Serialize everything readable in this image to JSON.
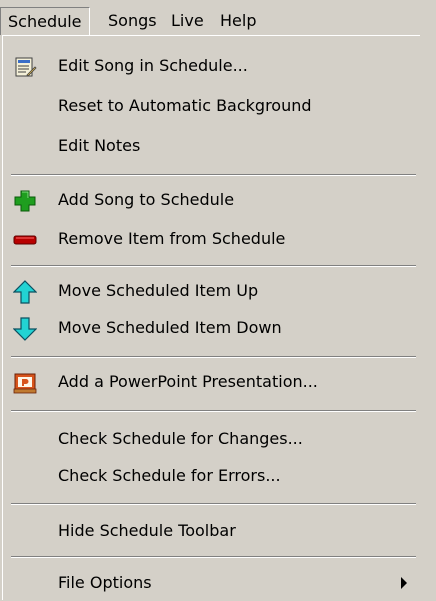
{
  "menubar": {
    "items": [
      {
        "label": "Schedule"
      },
      {
        "label": "Songs"
      },
      {
        "label": "Live"
      },
      {
        "label": "Help"
      }
    ]
  },
  "menu": {
    "items": [
      {
        "label": "Edit Song in Schedule...",
        "icon": "edit-song-icon"
      },
      {
        "label": "Reset to Automatic Background"
      },
      {
        "label": "Edit Notes"
      },
      {
        "label": "Add Song to Schedule",
        "icon": "plus-icon"
      },
      {
        "label": "Remove Item from Schedule",
        "icon": "minus-icon"
      },
      {
        "label": "Move Scheduled Item Up",
        "icon": "arrow-up-icon"
      },
      {
        "label": "Move Scheduled Item Down",
        "icon": "arrow-down-icon"
      },
      {
        "label": "Add a PowerPoint Presentation...",
        "icon": "powerpoint-icon"
      },
      {
        "label": "Check Schedule for Changes..."
      },
      {
        "label": "Check Schedule for Errors..."
      },
      {
        "label": "Hide Schedule Toolbar"
      },
      {
        "label": "File Options",
        "submenu": true
      }
    ]
  },
  "colors": {
    "background": "#d4d0c8",
    "green": "#1f9e1f",
    "red": "#b80000",
    "cyan": "#22d3d3",
    "ppt": "#d8541c"
  }
}
